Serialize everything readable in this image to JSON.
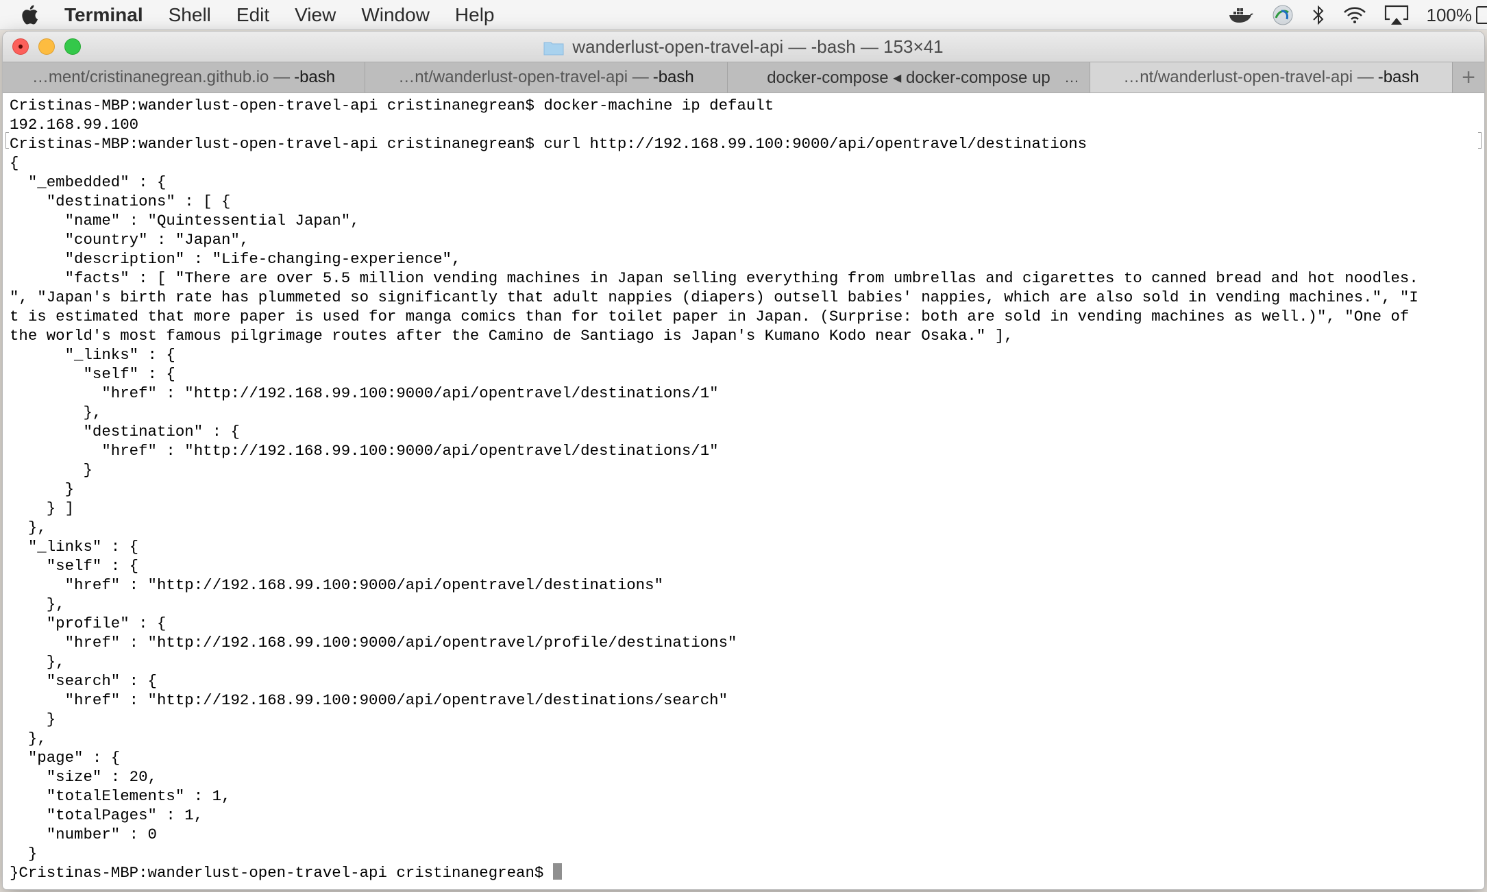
{
  "menubar": {
    "apple_icon": "apple-logo-icon",
    "app_name": "Terminal",
    "items": [
      "Shell",
      "Edit",
      "View",
      "Window",
      "Help"
    ],
    "status_icons": [
      "docker-icon",
      "globe-vpn-icon",
      "bluetooth-icon",
      "wifi-icon",
      "airplay-icon"
    ],
    "battery": "100%"
  },
  "window": {
    "title": "wanderlust-open-travel-api — -bash — 153×41",
    "tabs": [
      {
        "path": "…ment/cristinanegrean.github.io —",
        "process": "-bash",
        "active": false
      },
      {
        "path": "…nt/wanderlust-open-travel-api —",
        "process": "-bash",
        "active": false
      },
      {
        "path": "docker-compose ◂ docker-compose up",
        "process": "",
        "more": "…",
        "active": false
      },
      {
        "path": "…nt/wanderlust-open-travel-api —",
        "process": "-bash",
        "active": true
      }
    ],
    "new_tab_label": "+"
  },
  "terminal": {
    "lines": [
      "Cristinas-MBP:wanderlust-open-travel-api cristinanegrean$ docker-machine ip default",
      "192.168.99.100",
      "Cristinas-MBP:wanderlust-open-travel-api cristinanegrean$ curl http://192.168.99.100:9000/api/opentravel/destinations",
      "{",
      "  \"_embedded\" : {",
      "    \"destinations\" : [ {",
      "      \"name\" : \"Quintessential Japan\",",
      "      \"country\" : \"Japan\",",
      "      \"description\" : \"Life-changing-experience\",",
      "      \"facts\" : [ \"There are over 5.5 million vending machines in Japan selling everything from umbrellas and cigarettes to canned bread and hot noodles.",
      "\", \"Japan's birth rate has plummeted so significantly that adult nappies (diapers) outsell babies' nappies, which are also sold in vending machines.\", \"I",
      "t is estimated that more paper is used for manga comics than for toilet paper in Japan. (Surprise: both are sold in vending machines as well.)\", \"One of",
      "the world's most famous pilgrimage routes after the Camino de Santiago is Japan's Kumano Kodo near Osaka.\" ],",
      "      \"_links\" : {",
      "        \"self\" : {",
      "          \"href\" : \"http://192.168.99.100:9000/api/opentravel/destinations/1\"",
      "        },",
      "        \"destination\" : {",
      "          \"href\" : \"http://192.168.99.100:9000/api/opentravel/destinations/1\"",
      "        }",
      "      }",
      "    } ]",
      "  },",
      "  \"_links\" : {",
      "    \"self\" : {",
      "      \"href\" : \"http://192.168.99.100:9000/api/opentravel/destinations\"",
      "    },",
      "    \"profile\" : {",
      "      \"href\" : \"http://192.168.99.100:9000/api/opentravel/profile/destinations\"",
      "    },",
      "    \"search\" : {",
      "      \"href\" : \"http://192.168.99.100:9000/api/opentravel/destinations/search\"",
      "    }",
      "  },",
      "  \"page\" : {",
      "    \"size\" : 20,",
      "    \"totalElements\" : 1,",
      "    \"totalPages\" : 1,",
      "    \"number\" : 0",
      "  }"
    ],
    "prompt_line": "}Cristinas-MBP:wanderlust-open-travel-api cristinanegrean$ "
  }
}
